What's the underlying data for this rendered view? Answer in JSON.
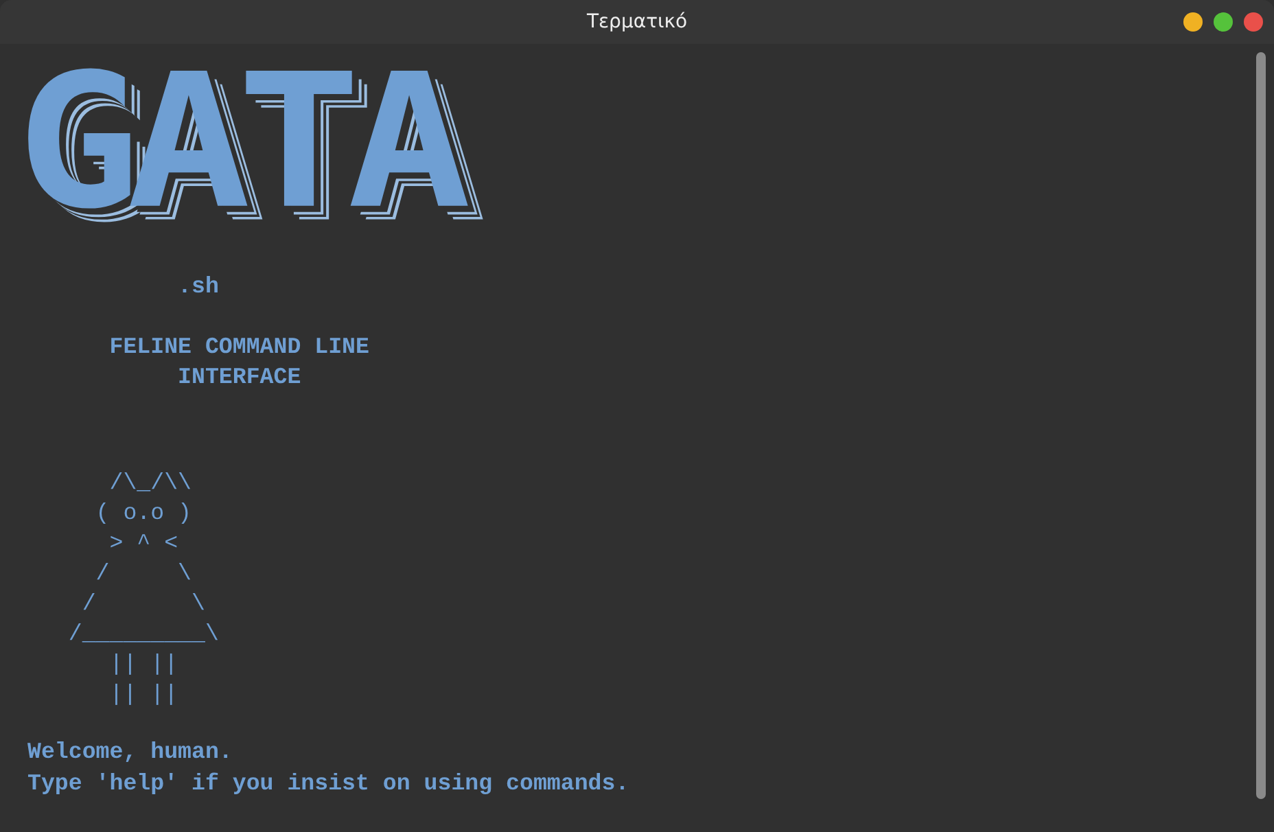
{
  "window": {
    "title": "Τερματικό"
  },
  "terminal": {
    "logo": "GATA",
    "subtitle": "           .sh",
    "tagline": [
      "      FELINE COMMAND LINE",
      "           INTERFACE"
    ],
    "cat_art": [
      "      /\\_/\\\\",
      "     ( o.o )",
      "      > ^ <",
      "     /     \\",
      "    /       \\",
      "   /_________\\",
      "      || ||",
      "      || ||"
    ],
    "messages": [
      "Welcome, human.",
      "Type 'help' if you insist on using commands."
    ]
  }
}
